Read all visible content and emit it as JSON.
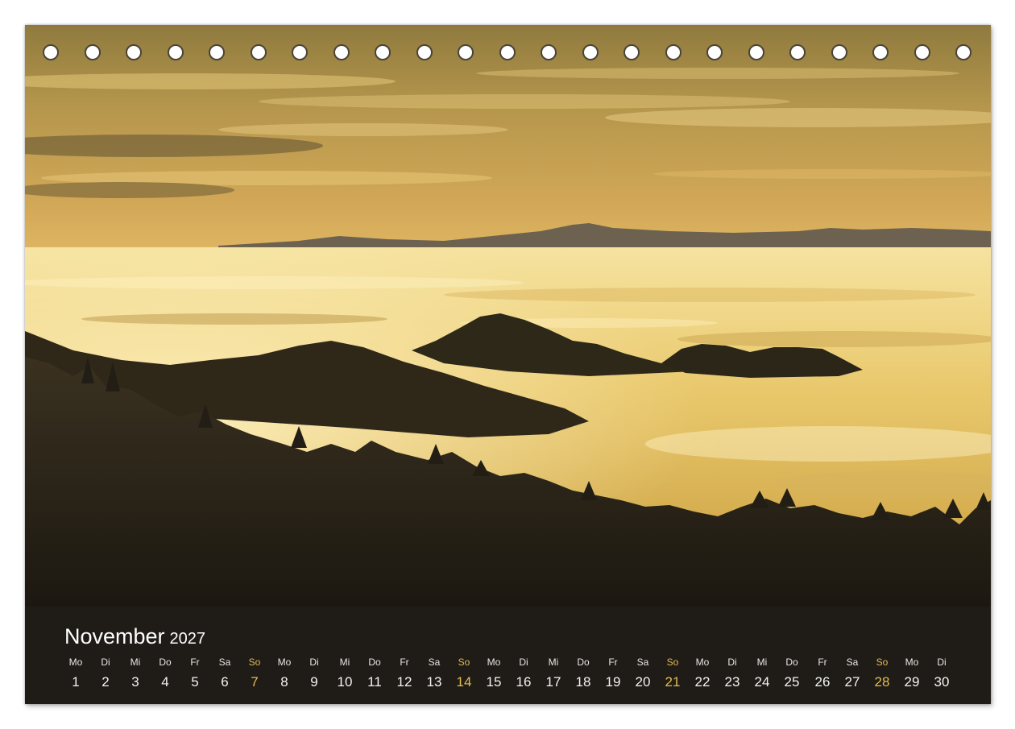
{
  "calendar": {
    "month": "November",
    "year": "2027",
    "days": [
      {
        "weekday": "Mo",
        "day": "1"
      },
      {
        "weekday": "Di",
        "day": "2"
      },
      {
        "weekday": "Mi",
        "day": "3"
      },
      {
        "weekday": "Do",
        "day": "4"
      },
      {
        "weekday": "Fr",
        "day": "5"
      },
      {
        "weekday": "Sa",
        "day": "6"
      },
      {
        "weekday": "So",
        "day": "7",
        "sunday": true
      },
      {
        "weekday": "Mo",
        "day": "8"
      },
      {
        "weekday": "Di",
        "day": "9"
      },
      {
        "weekday": "Mi",
        "day": "10"
      },
      {
        "weekday": "Do",
        "day": "11"
      },
      {
        "weekday": "Fr",
        "day": "12"
      },
      {
        "weekday": "Sa",
        "day": "13"
      },
      {
        "weekday": "So",
        "day": "14",
        "sunday": true
      },
      {
        "weekday": "Mo",
        "day": "15"
      },
      {
        "weekday": "Di",
        "day": "16"
      },
      {
        "weekday": "Mi",
        "day": "17"
      },
      {
        "weekday": "Do",
        "day": "18"
      },
      {
        "weekday": "Fr",
        "day": "19"
      },
      {
        "weekday": "Sa",
        "day": "20"
      },
      {
        "weekday": "So",
        "day": "21",
        "sunday": true
      },
      {
        "weekday": "Mo",
        "day": "22"
      },
      {
        "weekday": "Di",
        "day": "23"
      },
      {
        "weekday": "Mi",
        "day": "24"
      },
      {
        "weekday": "Do",
        "day": "25"
      },
      {
        "weekday": "Fr",
        "day": "26"
      },
      {
        "weekday": "Sa",
        "day": "27"
      },
      {
        "weekday": "So",
        "day": "28",
        "sunday": true
      },
      {
        "weekday": "Mo",
        "day": "29"
      },
      {
        "weekday": "Di",
        "day": "30"
      }
    ]
  },
  "colors": {
    "bar_background": "#1f1c17",
    "sunday_accent": "#e3bb56",
    "sky_gold": "#c9a24a",
    "fog_light": "#f3dd8e",
    "forest_dark": "#241f16"
  }
}
